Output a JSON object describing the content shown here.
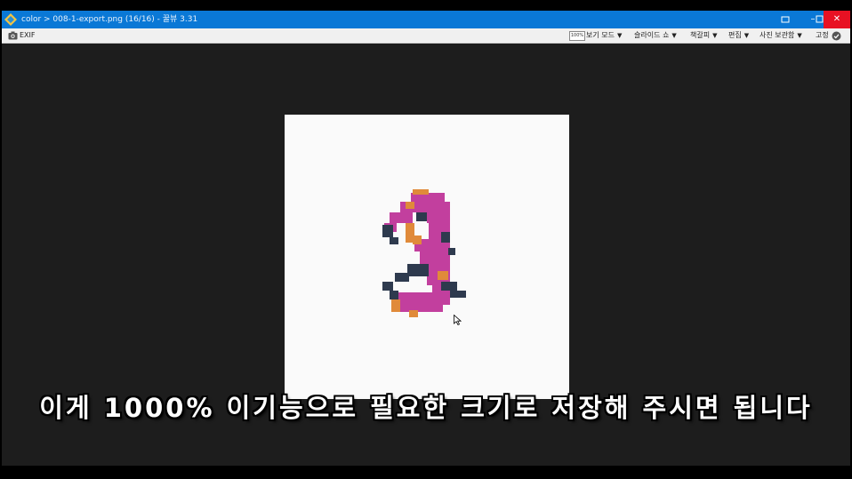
{
  "titlebar": {
    "title": "color > 008-1-export.png (16/16) - 꿀뷰 3.31",
    "app_icon": "honeyview-app-icon",
    "controls": [
      "a-icon",
      "minimize-icon",
      "maximize-icon",
      "close-icon"
    ]
  },
  "toolbar": {
    "exif_label": "EXIF",
    "zoom_badge": "100%",
    "menus": [
      {
        "label": "보기 모드"
      },
      {
        "label": "슬라이드 쇼"
      },
      {
        "label": "책갈피"
      },
      {
        "label": "편집"
      },
      {
        "label": "사진 보관함"
      }
    ],
    "pin_label": "고정"
  },
  "image": {
    "description_icon": "pixel-art-number-3",
    "colors": {
      "magenta": "#c23f9e",
      "navy": "#2e3a4e",
      "orange": "#e08a3a",
      "background": "#fafafa"
    }
  },
  "subtitle": "이게 1000% 이기능으로 필요한 크기로 저장해 주시면 됩니다"
}
